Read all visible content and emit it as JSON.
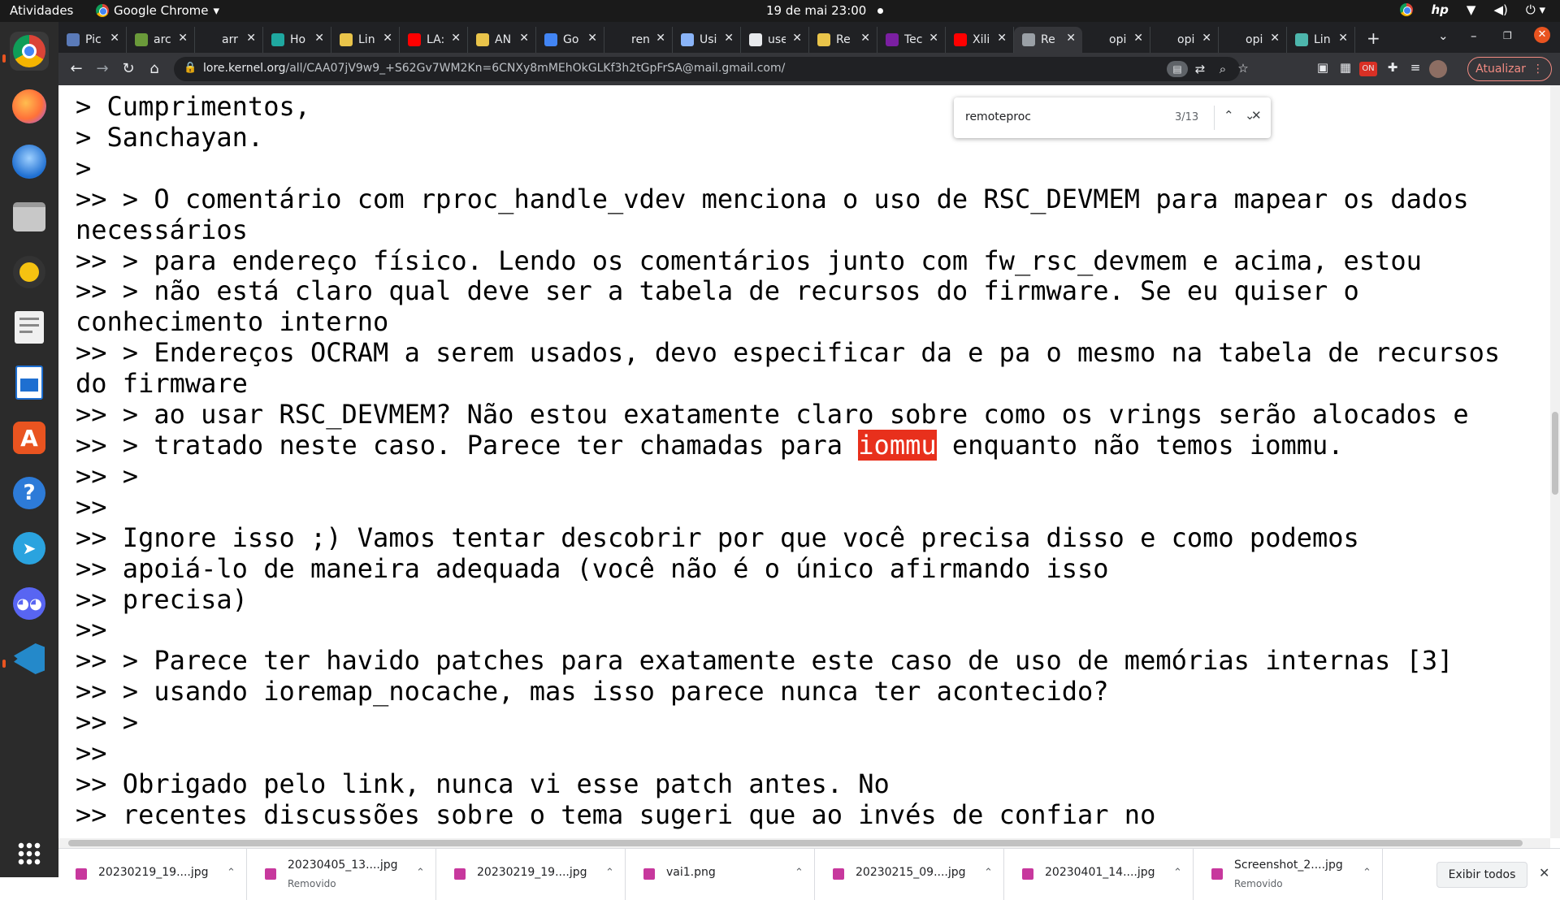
{
  "topbar": {
    "activities": "Atividades",
    "app_name": "Google Chrome",
    "clock": "19 de mai  23:00"
  },
  "browser": {
    "tabs": [
      {
        "title": "Pic",
        "favicon_color": "#5a7ab8"
      },
      {
        "title": "arc",
        "favicon_color": "#6a9a3a"
      },
      {
        "title": "arr",
        "favicon_color": "#202124"
      },
      {
        "title": "Ho",
        "favicon_color": "#1fa8a0"
      },
      {
        "title": "Lin",
        "favicon_color": "#e9c44a"
      },
      {
        "title": "LA:",
        "favicon_color": "#ff0000"
      },
      {
        "title": "AN",
        "favicon_color": "#e9c44a"
      },
      {
        "title": "Go",
        "favicon_color": "#4285f4"
      },
      {
        "title": "ren",
        "favicon_color": "#202124"
      },
      {
        "title": "Usi",
        "favicon_color": "#8ab4f8"
      },
      {
        "title": "use",
        "favicon_color": "#e8eaed"
      },
      {
        "title": "Re",
        "favicon_color": "#e9c44a"
      },
      {
        "title": "Tec",
        "favicon_color": "#7b1fa2"
      },
      {
        "title": "Xili",
        "favicon_color": "#ff0000"
      },
      {
        "title": "Re",
        "favicon_color": "#9aa0a6"
      },
      {
        "title": "opi",
        "favicon_color": "#202124"
      },
      {
        "title": "opi",
        "favicon_color": "#202124"
      },
      {
        "title": "opi",
        "favicon_color": "#202124"
      },
      {
        "title": "Lin",
        "favicon_color": "#4db6ac"
      }
    ],
    "active_tab_index": 14,
    "url_domain": "lore.kernel.org",
    "url_path": "/all/CAA07jV9w9_+S62Gv7WM2Kn=6CNXy8mMEhOkGLKf3h2tGpFrSA@mail.gmail.com/",
    "update_label": "Atualizar"
  },
  "find": {
    "query": "remoteproc",
    "count": "3/13"
  },
  "mail_lines": [
    {
      "pre": "> Cumprimentos,",
      "hl": "",
      "post": ""
    },
    {
      "pre": "> Sanchayan.",
      "hl": "",
      "post": ""
    },
    {
      "pre": ">",
      "hl": "",
      "post": ""
    },
    {
      "pre": ">> > O comentário com rproc_handle_vdev menciona o uso de RSC_DEVMEM para mapear os dados",
      "hl": "",
      "post": ""
    },
    {
      "pre": "necessários",
      "hl": "",
      "post": ""
    },
    {
      "pre": ">> > para endereço físico. Lendo os comentários junto com fw_rsc_devmem e acima, estou",
      "hl": "",
      "post": ""
    },
    {
      "pre": ">> > não está claro qual deve ser a tabela de recursos do firmware. Se eu quiser o",
      "hl": "",
      "post": ""
    },
    {
      "pre": "conhecimento interno",
      "hl": "",
      "post": ""
    },
    {
      "pre": ">> > Endereços OCRAM a serem usados, devo especificar da e pa o mesmo na tabela de recursos",
      "hl": "",
      "post": ""
    },
    {
      "pre": "do firmware",
      "hl": "",
      "post": ""
    },
    {
      "pre": ">> > ao usar RSC_DEVMEM? Não estou exatamente claro sobre como os vrings serão alocados e",
      "hl": "",
      "post": ""
    },
    {
      "pre": ">> > tratado neste caso. Parece ter chamadas para ",
      "hl": "iommu",
      "post": " enquanto não temos iommu."
    },
    {
      "pre": ">> >",
      "hl": "",
      "post": ""
    },
    {
      "pre": ">>",
      "hl": "",
      "post": ""
    },
    {
      "pre": ">> Ignore isso ;) Vamos tentar descobrir por que você precisa disso e como podemos",
      "hl": "",
      "post": ""
    },
    {
      "pre": ">> apoiá-lo de maneira adequada (você não é o único afirmando isso",
      "hl": "",
      "post": ""
    },
    {
      "pre": ">> precisa)",
      "hl": "",
      "post": ""
    },
    {
      "pre": ">>",
      "hl": "",
      "post": ""
    },
    {
      "pre": ">> > Parece ter havido patches para exatamente este caso de uso de memórias internas [3]",
      "hl": "",
      "post": ""
    },
    {
      "pre": ">> > usando ioremap_nocache, mas isso parece nunca ter acontecido?",
      "hl": "",
      "post": ""
    },
    {
      "pre": ">> >",
      "hl": "",
      "post": ""
    },
    {
      "pre": ">>",
      "hl": "",
      "post": ""
    },
    {
      "pre": ">> Obrigado pelo link, nunca vi esse patch antes. No",
      "hl": "",
      "post": ""
    },
    {
      "pre": ">> recentes discussões sobre o tema sugeri que ao invés de confiar no",
      "hl": "",
      "post": ""
    }
  ],
  "downloads": {
    "items": [
      {
        "name": "20230219_19....jpg",
        "status": ""
      },
      {
        "name": "20230405_13....jpg",
        "status": "Removido"
      },
      {
        "name": "20230219_19....jpg",
        "status": ""
      },
      {
        "name": "vai1.png",
        "status": ""
      },
      {
        "name": "20230215_09....jpg",
        "status": ""
      },
      {
        "name": "20230401_14....jpg",
        "status": ""
      },
      {
        "name": "Screenshot_2....jpg",
        "status": "Removido"
      }
    ],
    "show_all": "Exibir todos"
  },
  "colors": {
    "highlight": "#e8301c",
    "dock_bg": "#2b2b2b",
    "tabstrip_bg": "#202124",
    "toolbar_bg": "#35363a"
  }
}
